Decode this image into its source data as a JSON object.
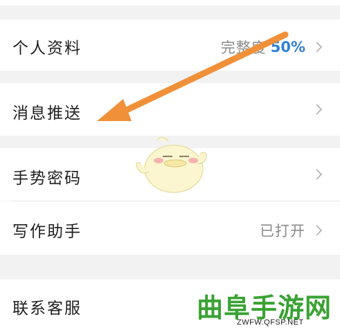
{
  "settings": {
    "profile": {
      "label": "个人资料",
      "value_prefix": "完整度",
      "value_accent": "50%"
    },
    "push": {
      "label": "消息推送"
    },
    "gesture": {
      "label": "手势密码"
    },
    "assistant": {
      "label": "写作助手",
      "value": "已打开"
    },
    "support": {
      "label": "联系客服"
    }
  },
  "icons": {
    "chevron": "chevron-right-icon",
    "annotation": "arrow-icon",
    "mascot": "mascot-sticker-icon"
  },
  "colors": {
    "background": "#f2f2f2",
    "row": "#ffffff",
    "text": "#1f1f1f",
    "muted": "#8a8a8a",
    "accent": "#2f80d6",
    "arrow": "#f0913a",
    "watermark": "#3aa233"
  },
  "watermark": {
    "title": "曲阜手游网",
    "url": "ZWFW.QFSP.NET"
  }
}
